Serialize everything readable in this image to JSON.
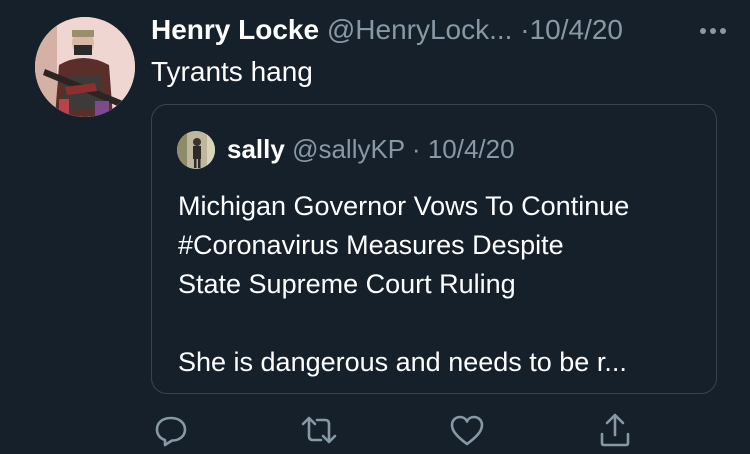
{
  "tweet": {
    "author_name": "Henry Locke",
    "author_handle": "@HenryLock...",
    "separator": "·",
    "date": "10/4/20",
    "text": "Tyrants hang",
    "more_icon": "more-horizontal-icon"
  },
  "quote": {
    "author_name": "sally",
    "author_handle": "@sallyKP",
    "separator": "·",
    "date": "10/4/20",
    "lines": [
      "Michigan Governor Vows To Continue",
      "#Coronavirus Measures Despite",
      "State Supreme Court Ruling",
      "She is dangerous and needs to be r..."
    ]
  },
  "actions": {
    "reply_icon": "reply-icon",
    "retweet_icon": "retweet-icon",
    "like_icon": "heart-icon",
    "share_icon": "share-icon"
  },
  "colors": {
    "background": "#15202b",
    "text": "#ffffff",
    "muted": "#8899a6",
    "border": "#38444d"
  }
}
